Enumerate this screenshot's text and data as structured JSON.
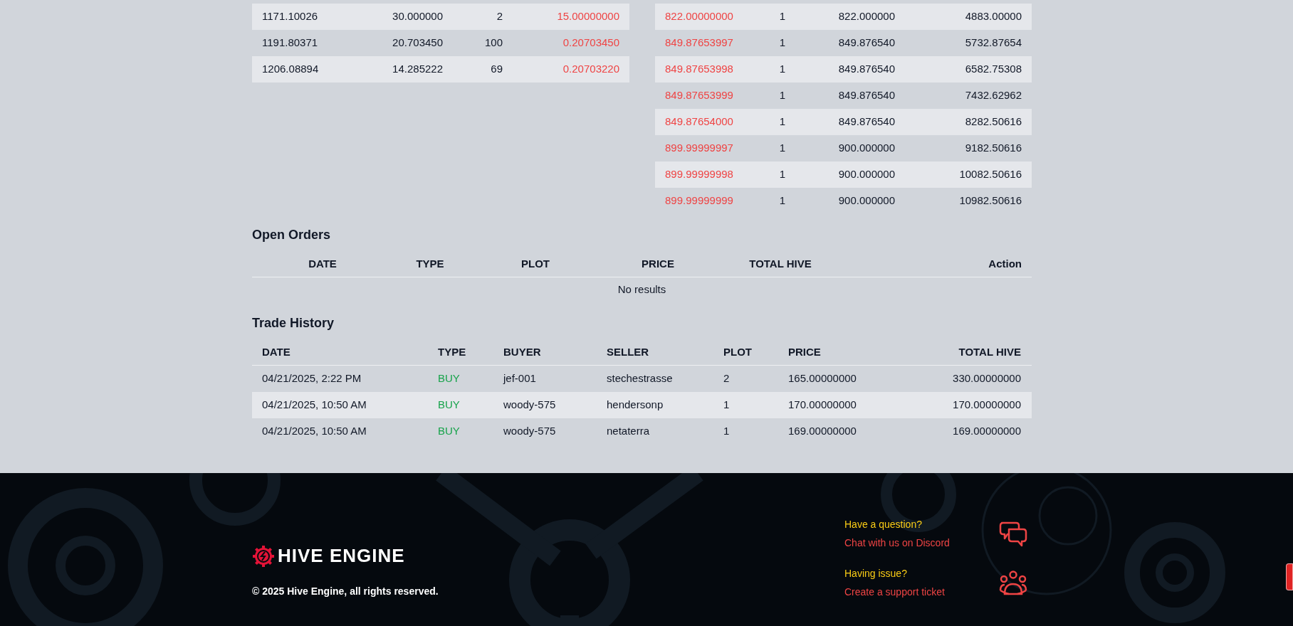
{
  "buy_orders": {
    "rows": [
      {
        "cells": [
          "1171.10026",
          "30.000000",
          "2",
          "15.00000000"
        ]
      },
      {
        "cells": [
          "1191.80371",
          "20.703450",
          "100",
          "0.20703450"
        ]
      },
      {
        "cells": [
          "1206.08894",
          "14.285222",
          "69",
          "0.20703220"
        ]
      }
    ]
  },
  "sell_orders": {
    "rows": [
      {
        "cells": [
          "822.00000000",
          "1",
          "822.000000",
          "4883.00000"
        ]
      },
      {
        "cells": [
          "849.87653997",
          "1",
          "849.876540",
          "5732.87654"
        ]
      },
      {
        "cells": [
          "849.87653998",
          "1",
          "849.876540",
          "6582.75308"
        ]
      },
      {
        "cells": [
          "849.87653999",
          "1",
          "849.876540",
          "7432.62962"
        ]
      },
      {
        "cells": [
          "849.87654000",
          "1",
          "849.876540",
          "8282.50616"
        ]
      },
      {
        "cells": [
          "899.99999997",
          "1",
          "900.000000",
          "9182.50616"
        ]
      },
      {
        "cells": [
          "899.99999998",
          "1",
          "900.000000",
          "10082.50616"
        ]
      },
      {
        "cells": [
          "899.99999999",
          "1",
          "900.000000",
          "10982.50616"
        ]
      }
    ]
  },
  "open_orders": {
    "title": "Open Orders",
    "columns": [
      "DATE",
      "TYPE",
      "PLOT",
      "PRICE",
      "TOTAL HIVE",
      "Action"
    ],
    "empty_text": "No results"
  },
  "trade_history": {
    "title": "Trade History",
    "columns": [
      "DATE",
      "TYPE",
      "BUYER",
      "SELLER",
      "PLOT",
      "PRICE",
      "TOTAL HIVE"
    ],
    "rows": [
      {
        "cells": [
          "04/21/2025, 2:22 PM",
          "BUY",
          "jef-001",
          "stechestrasse",
          "2",
          "165.00000000",
          "330.00000000"
        ]
      },
      {
        "cells": [
          "04/21/2025, 10:50 AM",
          "BUY",
          "woody-575",
          "hendersonp",
          "1",
          "170.00000000",
          "170.00000000"
        ]
      },
      {
        "cells": [
          "04/21/2025, 10:50 AM",
          "BUY",
          "woody-575",
          "netaterra",
          "1",
          "169.00000000",
          "169.00000000"
        ]
      }
    ]
  },
  "footer": {
    "logo_text": "HIVE ENGINE",
    "copyright": "© 2025 Hive Engine, all rights reserved.",
    "contacts": [
      {
        "kind": "chat",
        "question": "Have a question?",
        "link": "Chat with us on Discord"
      },
      {
        "kind": "support",
        "question": "Having issue?",
        "link": "Create a support ticket"
      }
    ]
  }
}
